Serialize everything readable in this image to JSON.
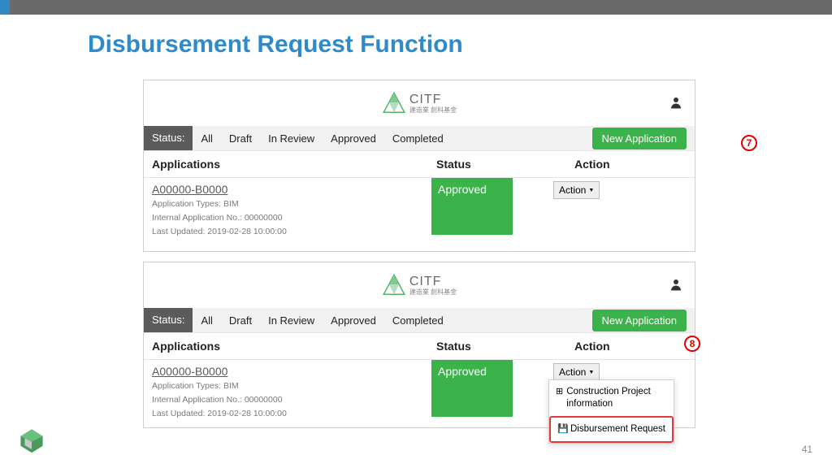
{
  "slide": {
    "title": "Disbursement Request Function",
    "page_number": "41",
    "annotations": {
      "step7": "7",
      "step8": "8"
    }
  },
  "brand": {
    "name": "CITF",
    "tagline": "建造業\n創科基金"
  },
  "filter": {
    "status_label": "Status:",
    "items": [
      "All",
      "Draft",
      "In Review",
      "Approved",
      "Completed"
    ],
    "new_application": "New Application"
  },
  "columns": {
    "applications": "Applications",
    "status": "Status",
    "action": "Action"
  },
  "row": {
    "id": "A00000-B0000",
    "type_label": "Application Types: BIM",
    "internal_label": "Internal Application No.: 00000000",
    "updated_label": "Last Updated: 2019-02-28 10:00:00",
    "status": "Approved",
    "action_label": "Action"
  },
  "dropdown": {
    "item1": "Construction Project information",
    "item2": "Disbursement Request"
  }
}
